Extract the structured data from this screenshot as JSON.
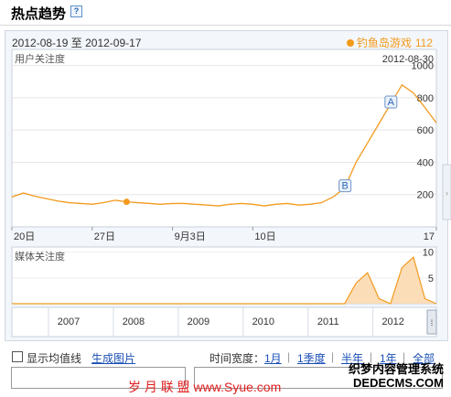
{
  "header": {
    "title": "热点趋势",
    "help_icon": "?"
  },
  "date_range": {
    "start": "2012-08-19",
    "sep": "至",
    "end": "2012-09-17"
  },
  "legend": {
    "name": "钓鱼岛游戏",
    "value": "112",
    "color": "#f39a1e"
  },
  "hover_date": "2012-08-30",
  "chart_data": [
    {
      "type": "line",
      "label": "用户关注度",
      "x_ticks": [
        "20日",
        "27日",
        "9月3日",
        "10日",
        "17"
      ],
      "y_ticks": [
        200,
        400,
        600,
        800,
        1000
      ],
      "ylim": [
        0,
        1100
      ],
      "values": [
        185,
        210,
        190,
        175,
        160,
        150,
        145,
        140,
        150,
        165,
        155,
        150,
        145,
        140,
        145,
        145,
        140,
        135,
        130,
        140,
        145,
        140,
        130,
        140,
        145,
        135,
        140,
        150,
        185,
        240,
        400,
        520,
        640,
        760,
        880,
        830,
        740,
        645
      ],
      "hover_index": 10,
      "annotations": [
        {
          "letter": "A",
          "index": 33
        },
        {
          "letter": "B",
          "index": 29
        }
      ],
      "color": "#f39a1e"
    },
    {
      "type": "area",
      "label": "媒体关注度",
      "y_ticks": [
        5,
        10
      ],
      "ylim": [
        0,
        11
      ],
      "values": [
        0,
        0,
        0,
        0,
        0,
        0,
        0,
        0,
        0,
        0,
        0,
        0,
        0,
        0,
        0,
        0,
        0,
        0,
        0,
        0,
        0,
        0,
        0,
        0,
        0,
        0,
        0,
        0,
        0,
        0,
        4,
        6,
        1,
        0,
        7,
        9,
        1,
        0
      ],
      "color": "#f39a1e"
    }
  ],
  "overview_years": [
    "2007",
    "2008",
    "2009",
    "2010",
    "2011",
    "2012"
  ],
  "controls": {
    "show_avg": "显示均值线",
    "gen_image": "生成图片",
    "time_label": "时间宽度：",
    "options": [
      "1月",
      "1季度",
      "半年",
      "1年",
      "全部"
    ]
  },
  "watermarks": {
    "left": "岁 月 联 盟  www.Syue.com",
    "right_line1": "织梦内容管理系统",
    "right_line2": "DEDECMS.COM"
  }
}
